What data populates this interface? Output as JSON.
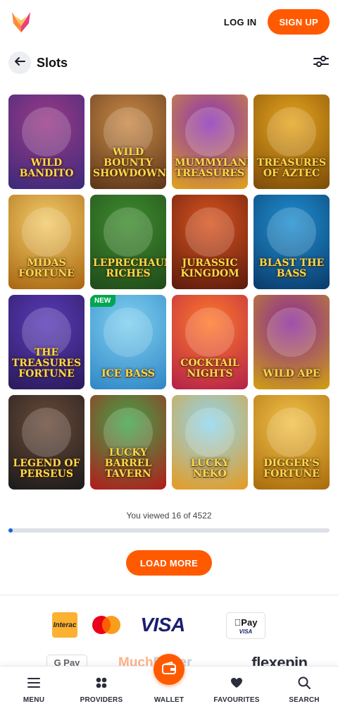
{
  "header": {
    "logo_icon": "brand-logo-icon",
    "login_label": "LOG IN",
    "signup_label": "SIGN UP"
  },
  "title_bar": {
    "back_icon": "arrow-left-icon",
    "title": "Slots",
    "filter_icon": "sliders-icon"
  },
  "games": [
    {
      "title": "Wild Bandito",
      "badge": "",
      "bg": [
        "#9a3a86",
        "#3b2a7a"
      ]
    },
    {
      "title": "Wild Bounty Showdown",
      "badge": "",
      "bg": [
        "#c98a48",
        "#5a3418"
      ]
    },
    {
      "title": "Mummyland Treasures",
      "badge": "",
      "bg": [
        "#8b32b8",
        "#e0a419"
      ]
    },
    {
      "title": "Treasures of Aztec",
      "badge": "",
      "bg": [
        "#e6a51e",
        "#7a4a08"
      ]
    },
    {
      "title": "Midas Fortune",
      "badge": "",
      "bg": [
        "#f2cc6a",
        "#a8650f"
      ]
    },
    {
      "title": "Leprechaun Riches",
      "badge": "",
      "bg": [
        "#3f8c2e",
        "#1f4a1a"
      ]
    },
    {
      "title": "Jurassic Kingdom",
      "badge": "",
      "bg": [
        "#d9541f",
        "#5a1a0c"
      ]
    },
    {
      "title": "Blast the Bass",
      "badge": "",
      "bg": [
        "#1f8fd0",
        "#0a3a6a"
      ]
    },
    {
      "title": "The Treasures Fortune",
      "badge": "",
      "bg": [
        "#5a3ab8",
        "#2a1a5a"
      ]
    },
    {
      "title": "Ice Bass",
      "badge": "NEW",
      "bg": [
        "#7fd0ef",
        "#2f86c6"
      ]
    },
    {
      "title": "Cocktail Nights",
      "badge": "",
      "bg": [
        "#ff7a2a",
        "#b3204a"
      ]
    },
    {
      "title": "Wild Ape",
      "badge": "",
      "bg": [
        "#8a2a9a",
        "#d0a010"
      ]
    },
    {
      "title": "Legend of Perseus",
      "badge": "",
      "bg": [
        "#6a4a3a",
        "#1a1a1a"
      ]
    },
    {
      "title": "Lucky Barrel Tavern",
      "badge": "",
      "bg": [
        "#3fa64a",
        "#b31a1a"
      ]
    },
    {
      "title": "Lucky Neko",
      "badge": "",
      "bg": [
        "#8fd6ef",
        "#e69a1f"
      ]
    },
    {
      "title": "Digger's Fortune",
      "badge": "",
      "bg": [
        "#f2c24a",
        "#a86a0a"
      ]
    }
  ],
  "progress": {
    "viewed_text": "You viewed 16 of 4522",
    "fraction": 0.0035,
    "color": "#1565d8"
  },
  "load_more_label": "LOAD MORE",
  "payments": {
    "interac_label": "Interac",
    "mastercard_icon": "mastercard-icon",
    "visa_label": "VISA",
    "applepay_label": "Pay",
    "applepay_sub": "VISA",
    "gpay_label": "G Pay",
    "muchbetter_label_a": "Much",
    "muchbetter_label_b": "Better",
    "flexepin_label": "flexepin"
  },
  "nav": {
    "menu_label": "MENU",
    "providers_label": "PROVIDERS",
    "wallet_label": "WALLET",
    "favourites_label": "FAVOURITES",
    "search_label": "SEARCH"
  },
  "colors": {
    "accent": "#ff5a00",
    "new_badge": "#00a651"
  }
}
